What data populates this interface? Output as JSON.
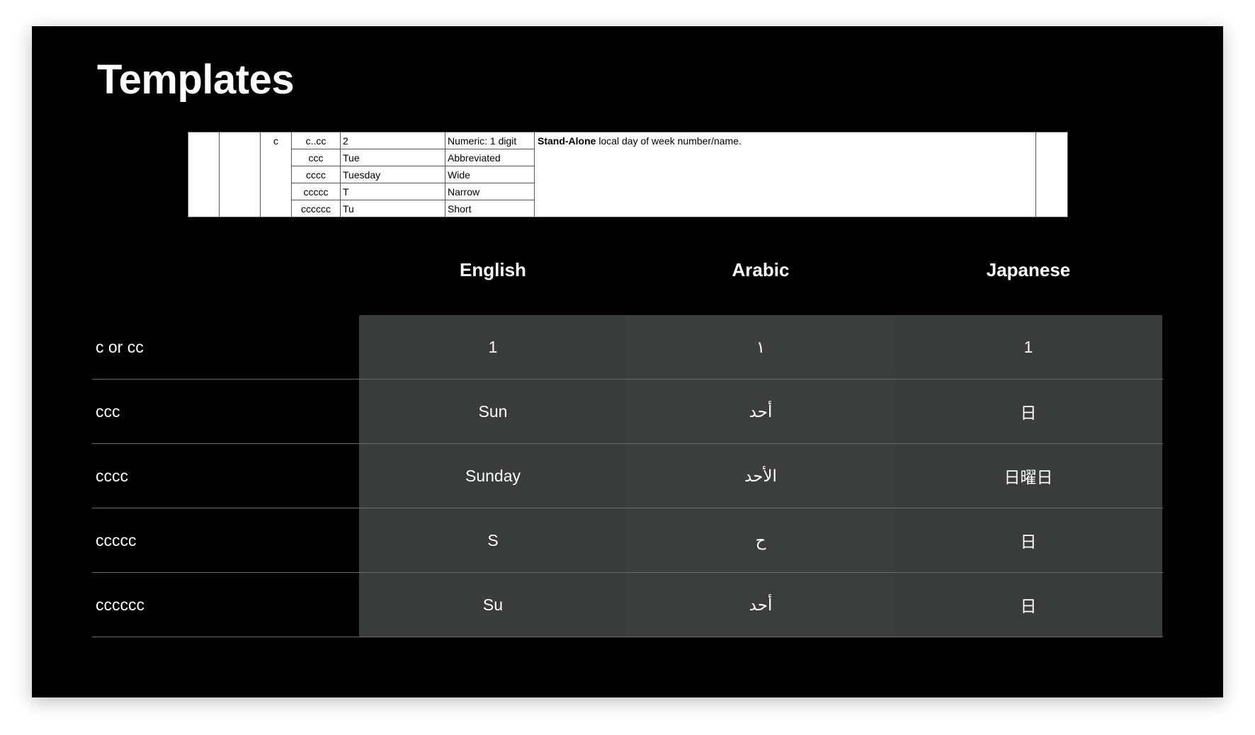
{
  "slide": {
    "title": "Templates"
  },
  "spec_table": {
    "symbol": "c",
    "desc_bold": "Stand-Alone",
    "desc_rest": " local day of week number/name.",
    "rows": [
      {
        "pattern": "c..cc",
        "example": "2",
        "meaning": "Numeric: 1 digit"
      },
      {
        "pattern": "ccc",
        "example": "Tue",
        "meaning": "Abbreviated"
      },
      {
        "pattern": "cccc",
        "example": "Tuesday",
        "meaning": "Wide"
      },
      {
        "pattern": "ccccc",
        "example": "T",
        "meaning": "Narrow"
      },
      {
        "pattern": "cccccc",
        "example": "Tu",
        "meaning": "Short"
      }
    ]
  },
  "table": {
    "columns": [
      "English",
      "Arabic",
      "Japanese"
    ],
    "rows": [
      {
        "label": "c or cc",
        "english": "1",
        "arabic": "١",
        "japanese": "1"
      },
      {
        "label": "ccc",
        "english": "Sun",
        "arabic": "أحد",
        "japanese": "日"
      },
      {
        "label": "cccc",
        "english": "Sunday",
        "arabic": "الأحد",
        "japanese": "日曜日"
      },
      {
        "label": "ccccc",
        "english": "S",
        "arabic": "ح",
        "japanese": "日"
      },
      {
        "label": "cccccc",
        "english": "Su",
        "arabic": "أحد",
        "japanese": "日"
      }
    ]
  }
}
